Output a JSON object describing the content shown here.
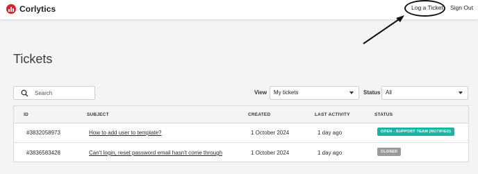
{
  "brand": {
    "name": "Corlytics"
  },
  "nav": {
    "log_ticket": "Log a Ticket",
    "sign_out": "Sign Out"
  },
  "page": {
    "title": "Tickets"
  },
  "search": {
    "placeholder": "Search",
    "value": ""
  },
  "filters": {
    "view_label": "View",
    "view_value": "My tickets",
    "status_label": "Status",
    "status_value": "All"
  },
  "table": {
    "headers": [
      "ID",
      "SUBJECT",
      "CREATED",
      "LAST ACTIVITY",
      "STATUS"
    ],
    "rows": [
      {
        "id": "#3832058973",
        "subject": "How to add user to template?",
        "created": "1 October 2024",
        "last_activity": "1 day ago",
        "status": "OPEN - SUPPORT TEAM (NOTIFIED)",
        "status_color": "#1bb3a3"
      },
      {
        "id": "#3836583428",
        "subject": "Can't login, reset password email hasn't come through",
        "created": "1 October 2024",
        "last_activity": "1 day ago",
        "status": "CLOSED",
        "status_color": "#9a9a9a"
      }
    ]
  },
  "colors": {
    "brand_red": "#d8232a",
    "background": "#f4f4f5"
  }
}
